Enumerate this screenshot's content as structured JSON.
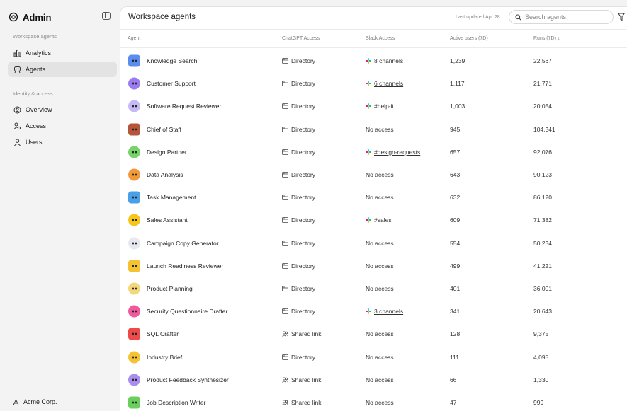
{
  "sidebar": {
    "title": "Admin",
    "section_agents": "Workspace agents",
    "items_agents": [
      {
        "label": "Analytics",
        "icon": "bar-chart-icon",
        "active": false
      },
      {
        "label": "Agents",
        "icon": "agent-icon",
        "active": true
      }
    ],
    "section_identity": "Identity & access",
    "items_identity": [
      {
        "label": "Overview",
        "icon": "overview-icon"
      },
      {
        "label": "Access",
        "icon": "access-icon"
      },
      {
        "label": "Users",
        "icon": "user-icon"
      }
    ],
    "footer": "Acme Corp."
  },
  "main": {
    "title": "Workspace agents",
    "updated": "Last updated Apr 28",
    "search_placeholder": "Search agents"
  },
  "table": {
    "columns": [
      "Agent",
      "ChatGPT Access",
      "Slack Access",
      "Active users (7D)",
      "Runs (7D) ↓"
    ],
    "rows": [
      {
        "agent": "Knowledge Search",
        "chatgpt": "Directory",
        "slack": "8 channels",
        "slack_type": "link",
        "active": "1,239",
        "runs": "22,567",
        "color": "#5b8def"
      },
      {
        "agent": "Customer Support",
        "chatgpt": "Directory",
        "slack": "6 channels",
        "slack_type": "link",
        "active": "1,117",
        "runs": "21,771",
        "color": "#9b7cf0"
      },
      {
        "agent": "Software Request Reviewer",
        "chatgpt": "Directory",
        "slack": "#help-it",
        "slack_type": "channel",
        "active": "1,003",
        "runs": "20,054",
        "color": "#c7b9f5"
      },
      {
        "agent": "Chief of Staff",
        "chatgpt": "Directory",
        "slack": "No access",
        "slack_type": "none",
        "active": "945",
        "runs": "104,341",
        "color": "#b5553a"
      },
      {
        "agent": "Design Partner",
        "chatgpt": "Directory",
        "slack": "#design-requests",
        "slack_type": "link",
        "active": "657",
        "runs": "92,076",
        "color": "#76d46a"
      },
      {
        "agent": "Data Analysis",
        "chatgpt": "Directory",
        "slack": "No access",
        "slack_type": "none",
        "active": "643",
        "runs": "90,123",
        "color": "#f29a3a"
      },
      {
        "agent": "Task Management",
        "chatgpt": "Directory",
        "slack": "No access",
        "slack_type": "none",
        "active": "632",
        "runs": "86,120",
        "color": "#4aa0e8"
      },
      {
        "agent": "Sales Assistant",
        "chatgpt": "Directory",
        "slack": "#sales",
        "slack_type": "channel",
        "active": "609",
        "runs": "71,382",
        "color": "#f5c518"
      },
      {
        "agent": "Campaign Copy Generator",
        "chatgpt": "Directory",
        "slack": "No access",
        "slack_type": "none",
        "active": "554",
        "runs": "50,234",
        "color": "#e8e8f0"
      },
      {
        "agent": "Launch Readiness Reviewer",
        "chatgpt": "Directory",
        "slack": "No access",
        "slack_type": "none",
        "active": "499",
        "runs": "41,221",
        "color": "#f5c232"
      },
      {
        "agent": "Product Planning",
        "chatgpt": "Directory",
        "slack": "No access",
        "slack_type": "none",
        "active": "401",
        "runs": "36,001",
        "color": "#f3d77a"
      },
      {
        "agent": "Security Questionnaire Drafter",
        "chatgpt": "Directory",
        "slack": "3 channels",
        "slack_type": "link",
        "active": "341",
        "runs": "20,643",
        "color": "#f05a9a"
      },
      {
        "agent": "SQL Crafter",
        "chatgpt": "Shared link",
        "slack": "No access",
        "slack_type": "none",
        "active": "128",
        "runs": "9,375",
        "color": "#ef4a4a"
      },
      {
        "agent": "Industry Brief",
        "chatgpt": "Directory",
        "slack": "No access",
        "slack_type": "none",
        "active": "111",
        "runs": "4,095",
        "color": "#f5c232"
      },
      {
        "agent": "Product Feedback Synthesizer",
        "chatgpt": "Shared link",
        "slack": "No access",
        "slack_type": "none",
        "active": "66",
        "runs": "1,330",
        "color": "#a98ef0"
      },
      {
        "agent": "Job Description Writer",
        "chatgpt": "Shared link",
        "slack": "No access",
        "slack_type": "none",
        "active": "47",
        "runs": "999",
        "color": "#6bcf5e"
      }
    ]
  }
}
